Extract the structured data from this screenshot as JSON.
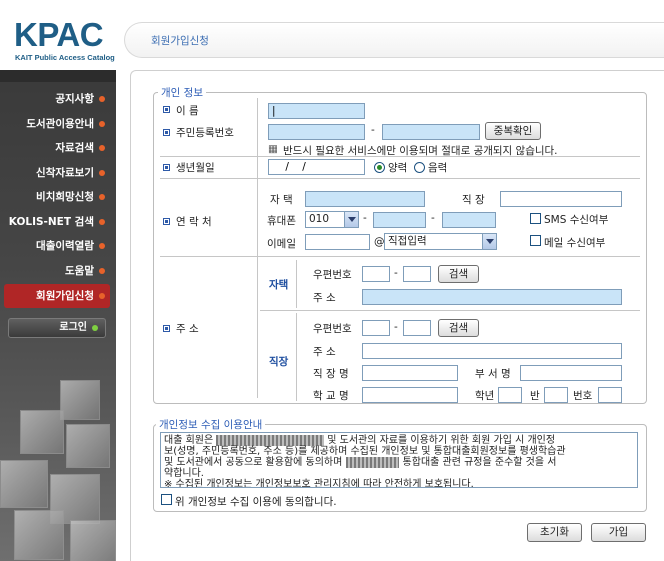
{
  "logo": {
    "title": "KPAC",
    "subtitle": "KAIT Public Access Catalog"
  },
  "sidebar": {
    "items": [
      {
        "label": "공지사항"
      },
      {
        "label": "도서관이용안내"
      },
      {
        "label": "자료검색"
      },
      {
        "label": "신착자료보기"
      },
      {
        "label": "비치희망신청"
      },
      {
        "label": "KOLIS-NET 검색"
      },
      {
        "label": "대출이력열람"
      },
      {
        "label": "도움말"
      },
      {
        "label": "회원가입신청"
      }
    ],
    "login_label": "로그인"
  },
  "header": {
    "title": "회원가입신청"
  },
  "personal": {
    "legend": "개인 정보",
    "name_label": "이    름",
    "name_value": "|",
    "rrn_label": "주민등록번호",
    "rrn_dash": "-",
    "dup_check_button": "중복확인",
    "rrn_note_icon": "▦",
    "rrn_note": "반드시 필요한 서비스에만 이용되며 절대로 공개되지 않습니다.",
    "birth_label": "생년월일",
    "birth_placeholder": "    /    /",
    "calendar_solar": "양력",
    "calendar_lunar": "음력",
    "contact_label": "연 락 처",
    "home_phone_label": "자    택",
    "work_phone_label": "직    장",
    "mobile_label": "휴대폰",
    "mobile_prefix": "010",
    "sms_label": "SMS 수신여부",
    "email_label": "이메일",
    "email_at": "@",
    "email_domain": "직접입력",
    "email_receive_label": "메일 수신여부",
    "address_label": "주    소",
    "home_addr_title": "자택",
    "work_addr_title": "직장",
    "zip_label": "우편번호",
    "addr_label": "주    소",
    "search_button": "검색",
    "workplace_label": "직 장 명",
    "department_label": "부 서 명",
    "school_label": "학 교 명",
    "grade_label": "학년",
    "class_label": "반",
    "number_label": "번호"
  },
  "privacy": {
    "legend": "개인정보 수집 이용안내",
    "line1a": "대출 회원은",
    "line1b": "및 도서관의 자료를 이용하기 위한 회원 가입 시 개인정",
    "line2": "보(성명, 주민등록번호, 주소 등)를 제공하며 수집된 개인정보 및 통합대출회원정보를 평생학습관",
    "line3": "및 도서관에서 공동으로 활용함에 동의하며",
    "line3b": "통합대출 관련 규정을 준수할 것을 서",
    "line4": "약합니다.",
    "line5": "※ 수집된 개인정보는 개인정보보호 관리지침에 따라 안전하게 보호됩니다.",
    "agree_label": "위 개인정보 수집 이용에 동의합니다."
  },
  "actions": {
    "reset": "초기화",
    "join": "가입"
  },
  "colors": {
    "brand": "#1f5e86",
    "accent_blue": "#2d5db6",
    "active_menu": "#b02626",
    "input_fill": "#c9e4f8"
  }
}
